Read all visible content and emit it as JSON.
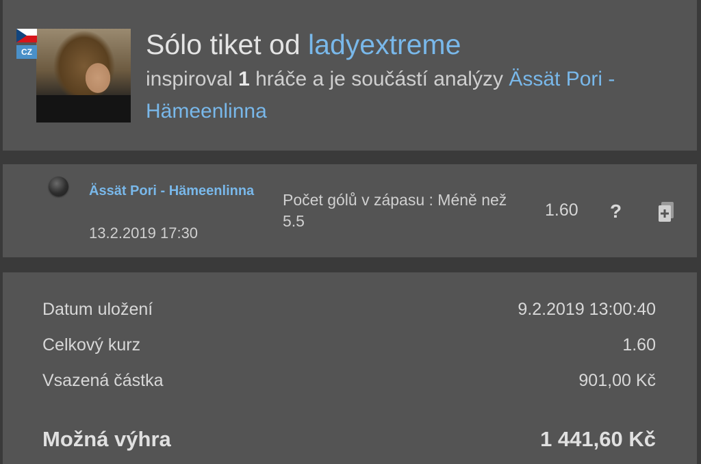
{
  "header": {
    "title_prefix": "Sólo tiket od",
    "author": "ladyextreme",
    "country_badge": "CZ",
    "inspired_prefix": "inspiroval",
    "inspired_count": "1",
    "inspired_suffix": "hráče a je součástí analýzy",
    "analysis_link": "Ässät Pori - Hämeenlinna"
  },
  "bet": {
    "status_icon": "result-pending-dot-icon",
    "match_name": "Ässät Pori - Hämeenlinna",
    "datetime": "13.2.2019 17:30",
    "market": "Počet gólů v zápasu : Méně než 5.5",
    "odds": "1.60",
    "help_symbol": "?",
    "help_icon": "question-mark-icon",
    "copy_icon": "copy-ticket-icon"
  },
  "summary": {
    "rows": [
      {
        "label": "Datum uložení",
        "value": "9.2.2019 13:00:40"
      },
      {
        "label": "Celkový kurz",
        "value": "1.60"
      },
      {
        "label": "Vsazená částka",
        "value": "901,00 Kč"
      }
    ],
    "win_label": "Možná výhra",
    "win_value": "1 441,60 Kč"
  },
  "colors": {
    "background": "#3a3a3a",
    "panel": "#545454",
    "link": "#79b8ea",
    "text": "#d6d6d6"
  }
}
